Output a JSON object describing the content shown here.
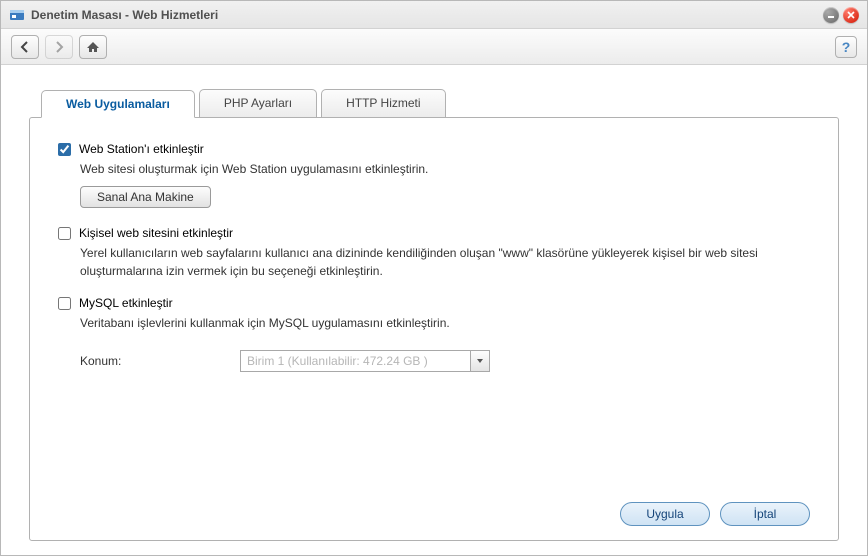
{
  "window": {
    "title": "Denetim Masası - Web Hizmetleri"
  },
  "toolbar": {
    "help_label": "?"
  },
  "tabs": [
    {
      "label": "Web Uygulamaları",
      "active": true
    },
    {
      "label": "PHP Ayarları",
      "active": false
    },
    {
      "label": "HTTP Hizmeti",
      "active": false
    }
  ],
  "webstation": {
    "checkbox_label": "Web Station'ı etkinleştir",
    "checked": true,
    "description": "Web sitesi oluşturmak için Web Station uygulamasını etkinleştirin.",
    "virtual_host_button": "Sanal Ana Makine"
  },
  "personal_site": {
    "checkbox_label": "Kişisel web sitesini etkinleştir",
    "checked": false,
    "description": "Yerel kullanıcıların web sayfalarını kullanıcı ana dizininde kendiliğinden oluşan \"www\" klasörüne yükleyerek kişisel bir web sitesi oluşturmalarına izin vermek için bu seçeneği etkinleştirin."
  },
  "mysql": {
    "checkbox_label": "MySQL etkinleştir",
    "checked": false,
    "description": "Veritabanı işlevlerini kullanmak için MySQL uygulamasını etkinleştirin.",
    "location_label": "Konum:",
    "location_value": "Birim 1 (Kullanılabilir: 472.24 GB )",
    "location_disabled": true
  },
  "footer": {
    "apply": "Uygula",
    "cancel": "İptal"
  }
}
